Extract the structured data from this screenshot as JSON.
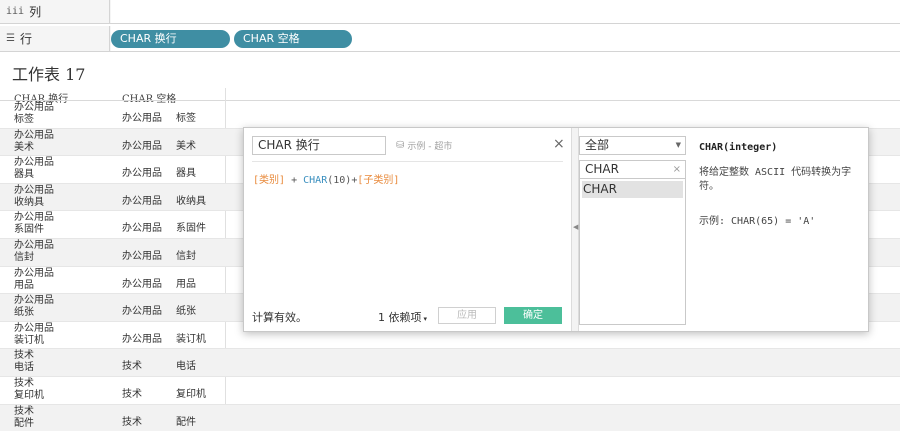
{
  "shelves": {
    "columns": {
      "icon": "iii",
      "label": "列"
    },
    "rows": {
      "icon": "☰",
      "label": "行",
      "pills": [
        "CHAR 换行",
        "CHAR 空格"
      ]
    }
  },
  "sheet": {
    "title": "工作表 17",
    "headers": {
      "col1": "CHAR 换行",
      "col2": "CHAR 空格"
    },
    "rows": [
      {
        "l1": "办公用品",
        "l2": "标签",
        "c2": "办公用品",
        "c3": "标签"
      },
      {
        "l1": "办公用品",
        "l2": "美术",
        "c2": "办公用品",
        "c3": "美术"
      },
      {
        "l1": "办公用品",
        "l2": "器具",
        "c2": "办公用品",
        "c3": "器具"
      },
      {
        "l1": "办公用品",
        "l2": "收纳具",
        "c2": "办公用品",
        "c3": "收纳具"
      },
      {
        "l1": "办公用品",
        "l2": "系固件",
        "c2": "办公用品",
        "c3": "系固件"
      },
      {
        "l1": "办公用品",
        "l2": "信封",
        "c2": "办公用品",
        "c3": "信封"
      },
      {
        "l1": "办公用品",
        "l2": "用品",
        "c2": "办公用品",
        "c3": "用品"
      },
      {
        "l1": "办公用品",
        "l2": "纸张",
        "c2": "办公用品",
        "c3": "纸张"
      },
      {
        "l1": "办公用品",
        "l2": "装订机",
        "c2": "办公用品",
        "c3": "装订机"
      },
      {
        "l1": "技术",
        "l2": "电话",
        "c2": "技术",
        "c3": "电话"
      },
      {
        "l1": "技术",
        "l2": "复印机",
        "c2": "技术",
        "c3": "复印机"
      },
      {
        "l1": "技术",
        "l2": "配件",
        "c2": "技术",
        "c3": "配件"
      }
    ]
  },
  "calc": {
    "name": "CHAR 换行",
    "datasource": "示例 - 超市",
    "close": "×",
    "formula": {
      "field1": "[类别]",
      "op1": "+",
      "func": "CHAR",
      "args": "(10)",
      "op2": "+",
      "field2": "[子类别]"
    },
    "status": "计算有效。",
    "dependencies": "1 依赖项",
    "apply_label": "应用",
    "ok_label": "确定",
    "category_select": "全部",
    "search_value": "CHAR",
    "search_clear": "×",
    "function_list": [
      "CHAR"
    ],
    "function_signature": "CHAR(integer)",
    "function_description": "将给定整数 ASCII 代码转换为字符。",
    "function_example": "示例: CHAR(65) = 'A'"
  },
  "colors": {
    "pill": "#3f8ea3",
    "ok_button": "#4cbf9a",
    "formula_field": "#e8893a",
    "formula_function": "#3a8fbf"
  }
}
